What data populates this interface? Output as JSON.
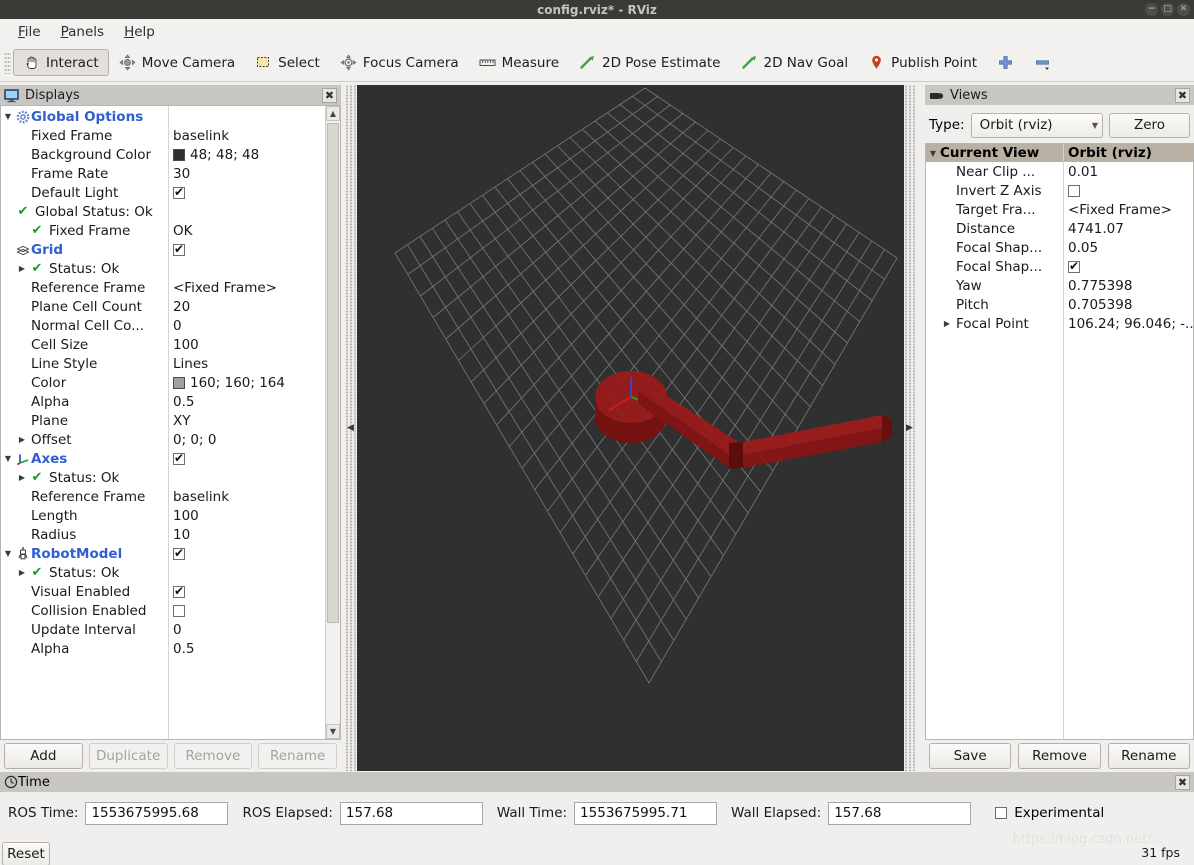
{
  "window": {
    "title": "config.rviz* - RViz",
    "controls": [
      "minimize",
      "maximize",
      "close"
    ]
  },
  "menubar": {
    "items": [
      {
        "label": "File",
        "mnemonic": "F"
      },
      {
        "label": "Panels",
        "mnemonic": "P"
      },
      {
        "label": "Help",
        "mnemonic": "H"
      }
    ]
  },
  "toolbar": {
    "buttons": [
      {
        "label": "Interact",
        "icon": "hand-cursor-icon",
        "active": true
      },
      {
        "label": "Move Camera",
        "icon": "move-camera-icon",
        "active": false
      },
      {
        "label": "Select",
        "icon": "select-rect-icon",
        "active": false
      },
      {
        "label": "Focus Camera",
        "icon": "focus-camera-icon",
        "active": false
      },
      {
        "label": "Measure",
        "icon": "ruler-icon",
        "active": false
      },
      {
        "label": "2D Pose Estimate",
        "icon": "green-arrow-icon",
        "active": false
      },
      {
        "label": "2D Nav Goal",
        "icon": "green-arrow-icon",
        "active": false
      },
      {
        "label": "Publish Point",
        "icon": "map-pin-icon",
        "active": false
      },
      {
        "label": "",
        "icon": "plus-icon",
        "active": false
      },
      {
        "label": "",
        "icon": "minus-icon",
        "active": false
      }
    ]
  },
  "displays": {
    "title": "Displays",
    "close_label": "✖",
    "rows": [
      {
        "twist": "down",
        "icon": "gear-icon",
        "indent": 0,
        "name": "Global Options",
        "name_style": "cat",
        "value_type": "none",
        "value": ""
      },
      {
        "twist": "",
        "icon": "",
        "indent": 1,
        "name": "Fixed Frame",
        "name_style": "",
        "value_type": "text",
        "value": "baselink"
      },
      {
        "twist": "",
        "icon": "",
        "indent": 1,
        "name": "Background Color",
        "name_style": "",
        "value_type": "color",
        "value": "48; 48; 48",
        "color": "#303030"
      },
      {
        "twist": "",
        "icon": "",
        "indent": 1,
        "name": "Frame Rate",
        "name_style": "",
        "value_type": "text",
        "value": "30"
      },
      {
        "twist": "",
        "icon": "",
        "indent": 1,
        "name": "Default Light",
        "name_style": "",
        "value_type": "check_on",
        "value": ""
      },
      {
        "twist": "",
        "icon": "check-ok-icon",
        "indent": 0,
        "name": "Global Status: Ok",
        "name_style": "",
        "value_type": "none",
        "value": ""
      },
      {
        "twist": "",
        "icon": "check-ok-icon",
        "indent": 1,
        "name": "Fixed Frame",
        "name_style": "",
        "value_type": "text",
        "value": "OK"
      },
      {
        "twist": "",
        "icon": "grid-icon",
        "indent": 0,
        "name": "Grid",
        "name_style": "cat",
        "value_type": "check_on",
        "value": ""
      },
      {
        "twist": "right",
        "icon": "check-ok-icon",
        "indent": 1,
        "name": "Status: Ok",
        "name_style": "",
        "value_type": "none",
        "value": ""
      },
      {
        "twist": "",
        "icon": "",
        "indent": 1,
        "name": "Reference Frame",
        "name_style": "",
        "value_type": "text",
        "value": "<Fixed Frame>"
      },
      {
        "twist": "",
        "icon": "",
        "indent": 1,
        "name": "Plane Cell Count",
        "name_style": "",
        "value_type": "text",
        "value": "20"
      },
      {
        "twist": "",
        "icon": "",
        "indent": 1,
        "name": "Normal Cell Co...",
        "name_style": "",
        "value_type": "text",
        "value": "0"
      },
      {
        "twist": "",
        "icon": "",
        "indent": 1,
        "name": "Cell Size",
        "name_style": "",
        "value_type": "text",
        "value": "100"
      },
      {
        "twist": "",
        "icon": "",
        "indent": 1,
        "name": "Line Style",
        "name_style": "",
        "value_type": "text",
        "value": "Lines"
      },
      {
        "twist": "",
        "icon": "",
        "indent": 1,
        "name": "Color",
        "name_style": "",
        "value_type": "color",
        "value": "160; 160; 164",
        "color": "#a0a0a4"
      },
      {
        "twist": "",
        "icon": "",
        "indent": 1,
        "name": "Alpha",
        "name_style": "",
        "value_type": "text",
        "value": "0.5"
      },
      {
        "twist": "",
        "icon": "",
        "indent": 1,
        "name": "Plane",
        "name_style": "",
        "value_type": "text",
        "value": "XY"
      },
      {
        "twist": "right",
        "icon": "",
        "indent": 1,
        "name": "Offset",
        "name_style": "",
        "value_type": "text",
        "value": "0; 0; 0"
      },
      {
        "twist": "down",
        "icon": "axes-icon",
        "indent": 0,
        "name": "Axes",
        "name_style": "cat",
        "value_type": "check_on",
        "value": ""
      },
      {
        "twist": "right",
        "icon": "check-ok-icon",
        "indent": 1,
        "name": "Status: Ok",
        "name_style": "",
        "value_type": "none",
        "value": ""
      },
      {
        "twist": "",
        "icon": "",
        "indent": 1,
        "name": "Reference Frame",
        "name_style": "",
        "value_type": "text",
        "value": "baselink"
      },
      {
        "twist": "",
        "icon": "",
        "indent": 1,
        "name": "Length",
        "name_style": "",
        "value_type": "text",
        "value": "100"
      },
      {
        "twist": "",
        "icon": "",
        "indent": 1,
        "name": "Radius",
        "name_style": "",
        "value_type": "text",
        "value": "10"
      },
      {
        "twist": "down",
        "icon": "robot-icon",
        "indent": 0,
        "name": "RobotModel",
        "name_style": "cat",
        "value_type": "check_on",
        "value": ""
      },
      {
        "twist": "right",
        "icon": "check-ok-icon",
        "indent": 1,
        "name": "Status: Ok",
        "name_style": "",
        "value_type": "none",
        "value": ""
      },
      {
        "twist": "",
        "icon": "",
        "indent": 1,
        "name": "Visual Enabled",
        "name_style": "",
        "value_type": "check_on",
        "value": ""
      },
      {
        "twist": "",
        "icon": "",
        "indent": 1,
        "name": "Collision Enabled",
        "name_style": "",
        "value_type": "check_off",
        "value": ""
      },
      {
        "twist": "",
        "icon": "",
        "indent": 1,
        "name": "Update Interval",
        "name_style": "",
        "value_type": "text",
        "value": "0"
      },
      {
        "twist": "",
        "icon": "",
        "indent": 1,
        "name": "Alpha",
        "name_style": "",
        "value_type": "text",
        "value": "0.5"
      }
    ],
    "buttons": [
      {
        "label": "Add",
        "enabled": true
      },
      {
        "label": "Duplicate",
        "enabled": false
      },
      {
        "label": "Remove",
        "enabled": false
      },
      {
        "label": "Rename",
        "enabled": false
      }
    ]
  },
  "views": {
    "title": "Views",
    "close_label": "✖",
    "type_label": "Type:",
    "type_value": "Orbit (rviz)",
    "zero_label": "Zero",
    "header": {
      "name": "Current View",
      "value": "Orbit (rviz)"
    },
    "rows": [
      {
        "twist": "",
        "indent": 1,
        "name": "Near Clip ...",
        "value_type": "text",
        "value": "0.01"
      },
      {
        "twist": "",
        "indent": 1,
        "name": "Invert Z Axis",
        "value_type": "check_off",
        "value": ""
      },
      {
        "twist": "",
        "indent": 1,
        "name": "Target Fra...",
        "value_type": "text",
        "value": "<Fixed Frame>"
      },
      {
        "twist": "",
        "indent": 1,
        "name": "Distance",
        "value_type": "text",
        "value": "4741.07"
      },
      {
        "twist": "",
        "indent": 1,
        "name": "Focal Shap...",
        "value_type": "text",
        "value": "0.05"
      },
      {
        "twist": "",
        "indent": 1,
        "name": "Focal Shap...",
        "value_type": "check_on",
        "value": ""
      },
      {
        "twist": "",
        "indent": 1,
        "name": "Yaw",
        "value_type": "text",
        "value": "0.775398"
      },
      {
        "twist": "",
        "indent": 1,
        "name": "Pitch",
        "value_type": "text",
        "value": "0.705398"
      },
      {
        "twist": "right",
        "indent": 1,
        "name": "Focal Point",
        "value_type": "text",
        "value": "106.24; 96.046; -..."
      }
    ],
    "buttons": [
      {
        "label": "Save",
        "enabled": true
      },
      {
        "label": "Remove",
        "enabled": true
      },
      {
        "label": "Rename",
        "enabled": true
      }
    ]
  },
  "viewport": {
    "background_color": "#303030",
    "grid_color": "#a0a0a4",
    "robot_color": "#8c1414",
    "left_arrow": "◀",
    "right_arrow": "▶"
  },
  "time": {
    "title": "Time",
    "close_label": "✖",
    "fields": [
      {
        "label": "ROS Time:",
        "value": "1553675995.68"
      },
      {
        "label": "ROS Elapsed:",
        "value": "157.68"
      },
      {
        "label": "Wall Time:",
        "value": "1553675995.71"
      },
      {
        "label": "Wall Elapsed:",
        "value": "157.68"
      }
    ],
    "experimental_label": "Experimental",
    "experimental_checked": false,
    "reset_label": "Reset"
  },
  "statusbar": {
    "fps": "31 fps",
    "watermark": "https://blog.csdn.net/..."
  }
}
